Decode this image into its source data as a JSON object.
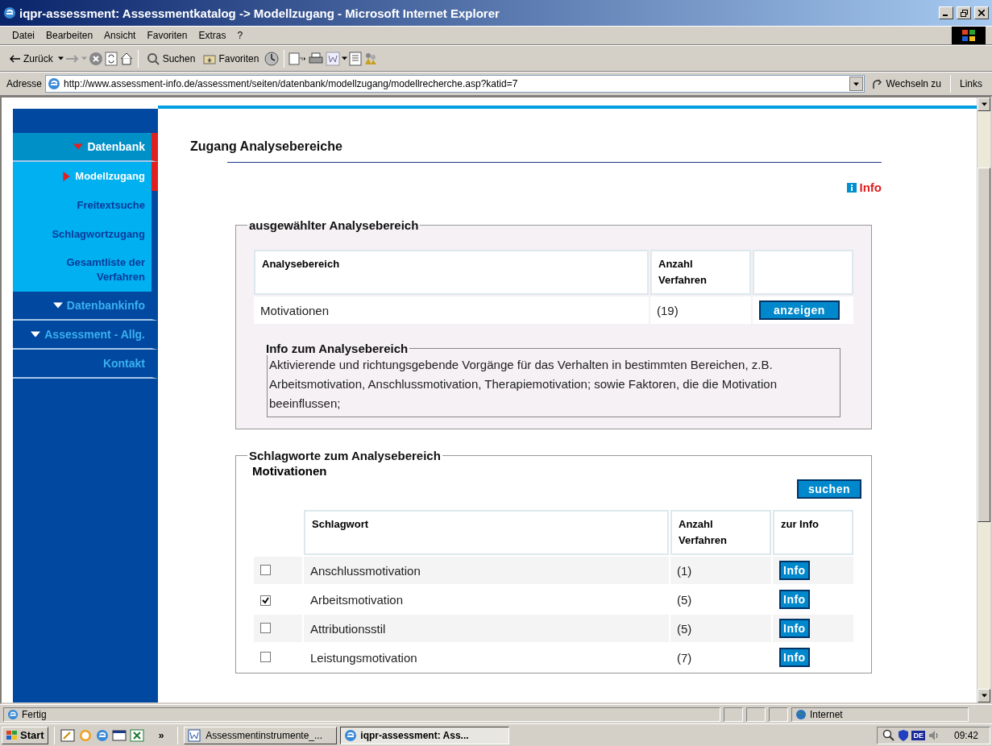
{
  "window": {
    "title": "iqpr-assessment: Assessmentkatalog -> Modellzugang - Microsoft Internet Explorer"
  },
  "menu": [
    "Datei",
    "Bearbeiten",
    "Ansicht",
    "Favoriten",
    "Extras",
    "?"
  ],
  "toolbar": {
    "back": "Zurück",
    "search": "Suchen",
    "favorites": "Favoriten"
  },
  "address": {
    "label": "Adresse",
    "value": "http://www.assessment-info.de/assessment/seiten/datenbank/modellzugang/modellrecherche.asp?katid=7",
    "go": "Wechseln zu",
    "links": "Links"
  },
  "sidebar": {
    "items": [
      {
        "kind": "section",
        "label": "Datenbank",
        "selected": true
      },
      {
        "kind": "sub",
        "label": "Modellzugang",
        "selected": true
      },
      {
        "kind": "sub",
        "label": "Freitextsuche",
        "selected": false
      },
      {
        "kind": "sub",
        "label": "Schlagwortzugang",
        "selected": false
      },
      {
        "kind": "sub",
        "label": "Gesamtliste der Verfahren",
        "selected": false
      },
      {
        "kind": "section",
        "label": "Datenbankinfo",
        "selected": false
      },
      {
        "kind": "section",
        "label": "Assessment - Allg.",
        "selected": false
      },
      {
        "kind": "plain",
        "label": "Kontakt"
      }
    ]
  },
  "main": {
    "heading": "Zugang Analysebereiche",
    "info_link": "Info",
    "selected_area": {
      "legend": "ausgewählter Analysebereich",
      "columns": [
        "Analysebereich",
        "Anzahl Verfahren"
      ],
      "row": {
        "name": "Motivationen",
        "count": "(19)",
        "button": "anzeigen"
      },
      "info": {
        "legend": "Info zum Analysebereich",
        "text": "Aktivierende und richtungsgebende Vorgänge für das Verhalten in bestimmten Bereichen, z.B. Arbeitsmotivation, Anschlussmotivation, Therapiemotivation; sowie Faktoren, die die Motivation beeinflussen;"
      }
    },
    "keywords": {
      "legend": "Schlagworte zum Analysebereich",
      "subtitle": "Motivationen",
      "search_button": "suchen",
      "columns": [
        "Schlagwort",
        "Anzahl Verfahren",
        "zur Info"
      ],
      "rows": [
        {
          "checked": false,
          "name": "Anschlussmotivation",
          "count": "(1)",
          "button": "Info"
        },
        {
          "checked": true,
          "name": "Arbeitsmotivation",
          "count": "(5)",
          "button": "Info"
        },
        {
          "checked": false,
          "name": "Attributionsstil",
          "count": "(5)",
          "button": "Info"
        },
        {
          "checked": false,
          "name": "Leistungsmotivation",
          "count": "(7)",
          "button": "Info"
        }
      ]
    }
  },
  "status_bar": {
    "text": "Fertig",
    "zone": "Internet"
  },
  "taskbar": {
    "start": "Start",
    "more": "»",
    "tasks": [
      {
        "label": "Assessmentinstrumente_...",
        "selected": false
      },
      {
        "label": "iqpr-assessment: Ass...",
        "selected": true
      }
    ],
    "clock": "09:42",
    "lang": "DE"
  }
}
